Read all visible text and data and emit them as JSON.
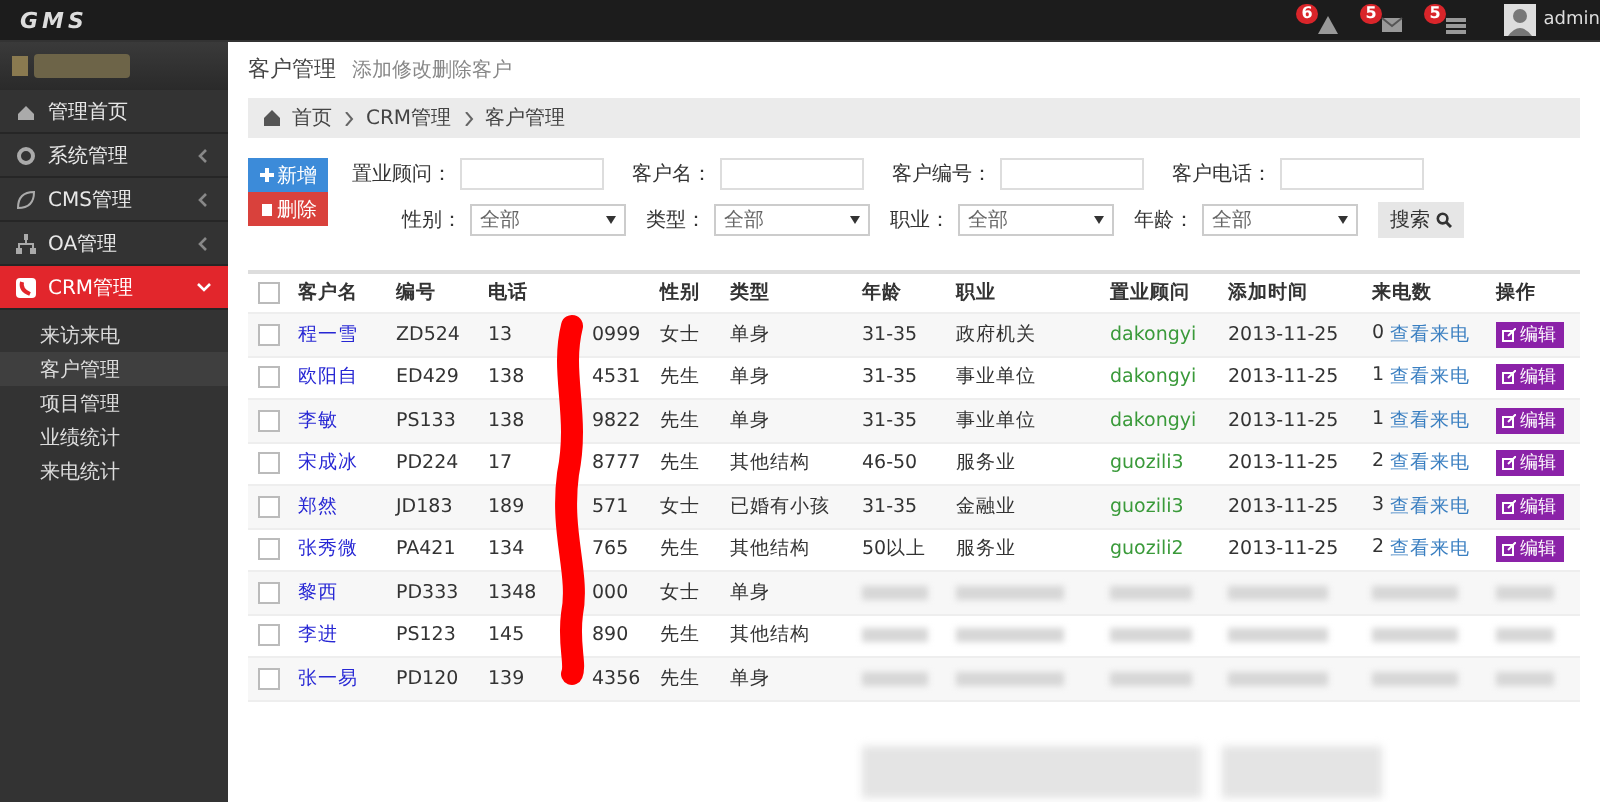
{
  "topbar": {
    "logo": "GMS",
    "notifications": [
      {
        "kind": "alert",
        "count": "6"
      },
      {
        "kind": "mail",
        "count": "5"
      },
      {
        "kind": "task",
        "count": "5"
      }
    ],
    "user": "admin"
  },
  "sidebar": {
    "items": [
      {
        "label": "管理首页",
        "selected": false
      },
      {
        "label": "系统管理",
        "selected": false,
        "expanded": false
      },
      {
        "label": "CMS管理",
        "selected": false,
        "expanded": false
      },
      {
        "label": "OA管理",
        "selected": false,
        "expanded": false
      },
      {
        "label": "CRM管理",
        "selected": true,
        "expanded": true,
        "children": [
          {
            "label": "来访来电",
            "selected": false
          },
          {
            "label": "客户管理",
            "selected": true
          },
          {
            "label": "项目管理",
            "selected": false
          },
          {
            "label": "业绩统计",
            "selected": false
          },
          {
            "label": "来电统计",
            "selected": false
          }
        ]
      }
    ]
  },
  "page": {
    "title": "客户管理",
    "subtitle": "添加修改删除客户",
    "breadcrumb": [
      "首页",
      "CRM管理",
      "客户管理"
    ]
  },
  "actions": [
    {
      "kind": "add",
      "label": "新增"
    },
    {
      "kind": "delete",
      "label": "删除"
    }
  ],
  "filters": {
    "inputs": [
      {
        "label": "置业顾问："
      },
      {
        "label": "客户名："
      },
      {
        "label": "客户编号："
      },
      {
        "label": "客户电话："
      }
    ],
    "selects": [
      {
        "label": "性别：",
        "value": "全部"
      },
      {
        "label": "类型：",
        "value": "全部"
      },
      {
        "label": "职业：",
        "value": "全部"
      },
      {
        "label": "年龄：",
        "value": "全部"
      }
    ],
    "search_button": "搜索"
  },
  "table": {
    "select_all_checked": false,
    "columns": [
      "客户名",
      "编号",
      "电话",
      "性别",
      "类型",
      "年龄",
      "职业",
      "置业顾问",
      "添加时间",
      "来电数",
      "操作"
    ],
    "rows": [
      {
        "checked": false,
        "blurred": false,
        "name": "程一雪",
        "code": "ZD524",
        "phone_start": "13",
        "phone_end": "0999",
        "gender": "女士",
        "type": "单身",
        "age": "31-35",
        "job": "政府机关",
        "advisor": "dakongyi",
        "date": "2013-11-25",
        "calls": "0",
        "calls_link": "查看来电",
        "edit": "编辑"
      },
      {
        "checked": false,
        "blurred": false,
        "name": "欧阳自",
        "code": "ED429",
        "phone_start": "138",
        "phone_end": "4531",
        "gender": "先生",
        "type": "单身",
        "age": "31-35",
        "job": "事业单位",
        "advisor": "dakongyi",
        "date": "2013-11-25",
        "calls": "1",
        "calls_link": "查看来电",
        "edit": "编辑"
      },
      {
        "checked": false,
        "blurred": false,
        "name": "李敏",
        "code": "PS133",
        "phone_start": "138",
        "phone_end": "9822",
        "gender": "先生",
        "type": "单身",
        "age": "31-35",
        "job": "事业单位",
        "advisor": "dakongyi",
        "date": "2013-11-25",
        "calls": "1",
        "calls_link": "查看来电",
        "edit": "编辑"
      },
      {
        "checked": false,
        "blurred": false,
        "name": "宋成冰",
        "code": "PD224",
        "phone_start": "17",
        "phone_end": "8777",
        "gender": "先生",
        "type": "其他结构",
        "age": "46-50",
        "job": "服务业",
        "advisor": "guozili3",
        "date": "2013-11-25",
        "calls": "2",
        "calls_link": "查看来电",
        "edit": "编辑"
      },
      {
        "checked": false,
        "blurred": false,
        "name": "郑然",
        "code": "JD183",
        "phone_start": "189",
        "phone_end": "571",
        "gender": "女士",
        "type": "已婚有小孩",
        "age": "31-35",
        "job": "金融业",
        "advisor": "guozili3",
        "date": "2013-11-25",
        "calls": "3",
        "calls_link": "查看来电",
        "edit": "编辑"
      },
      {
        "checked": false,
        "blurred": false,
        "name": "张秀微",
        "code": "PA421",
        "phone_start": "134",
        "phone_end": "765",
        "gender": "先生",
        "type": "其他结构",
        "age": "50以上",
        "job": "服务业",
        "advisor": "guozili2",
        "date": "2013-11-25",
        "calls": "2",
        "calls_link": "查看来电",
        "edit": "编辑"
      },
      {
        "checked": false,
        "blurred": true,
        "name": "黎西",
        "code": "PD333",
        "phone_start": "1348",
        "phone_end": "000",
        "gender": "女士",
        "type": "单身"
      },
      {
        "checked": false,
        "blurred": true,
        "name": "李进",
        "code": "PS123",
        "phone_start": "145",
        "phone_end": "890",
        "gender": "先生",
        "type": "其他结构"
      },
      {
        "checked": false,
        "blurred": true,
        "name": "张一易",
        "code": "PD120",
        "phone_start": "139",
        "phone_end": "4356",
        "gender": "先生",
        "type": "单身"
      }
    ]
  }
}
